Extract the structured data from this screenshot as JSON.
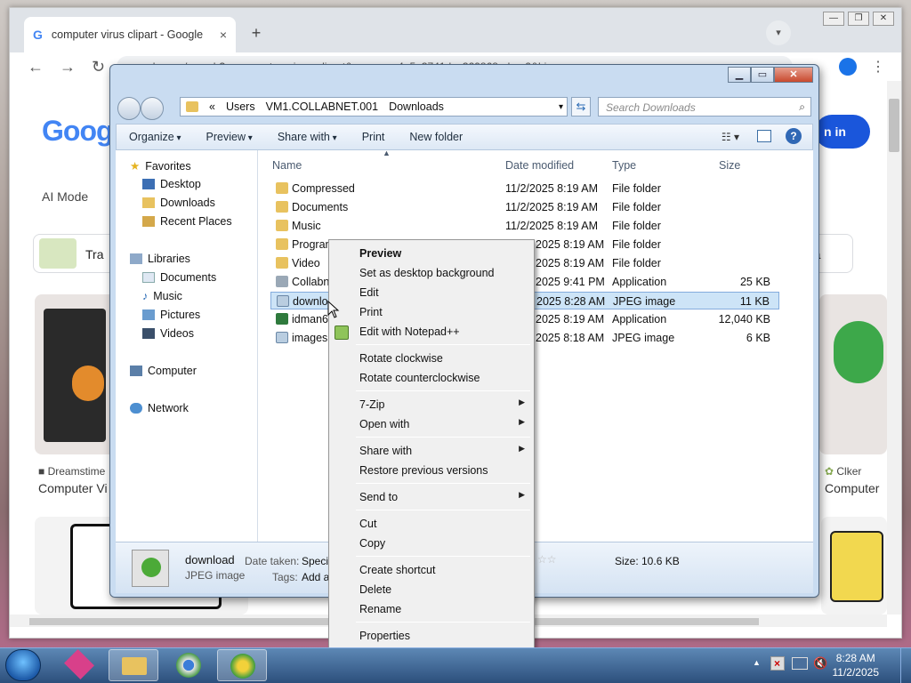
{
  "chrome": {
    "tab_title": "computer virus clipart - Google",
    "tab_close": "×",
    "new_tab": "+",
    "omnibox_text": "google.com/search?q=computer+virus+clipart&sca_esv=4a5e3741dec329868udm=2&biw=",
    "window_controls": [
      "—",
      "❐",
      "✕"
    ]
  },
  "google": {
    "logo": "Goog",
    "ai_mode": "AI Mode",
    "sign_in": "n in",
    "chip_left": "Tra",
    "chip_right": "ra",
    "source_left": "Dreamstime",
    "caption_left": "Computer Vi",
    "source_right": "Clker",
    "caption_right": "Computer"
  },
  "explorer": {
    "breadcrumb": [
      "«",
      "Users",
      "VM1.COLLABNET.001",
      "Downloads"
    ],
    "search_placeholder": "Search Downloads",
    "commands": [
      "Organize",
      "Preview",
      "Share with",
      "Print",
      "New folder"
    ],
    "nav": {
      "favorites": "Favorites",
      "desktop": "Desktop",
      "downloads": "Downloads",
      "recent": "Recent Places",
      "libraries": "Libraries",
      "documents": "Documents",
      "music": "Music",
      "pictures": "Pictures",
      "videos": "Videos",
      "computer": "Computer",
      "network": "Network"
    },
    "columns": {
      "name": "Name",
      "date": "Date modified",
      "type": "Type",
      "size": "Size"
    },
    "files": [
      {
        "name": "Compressed",
        "date": "11/2/2025 8:19 AM",
        "type": "File folder",
        "size": ""
      },
      {
        "name": "Documents",
        "date": "11/2/2025 8:19 AM",
        "type": "File folder",
        "size": ""
      },
      {
        "name": "Music",
        "date": "11/2/2025 8:19 AM",
        "type": "File folder",
        "size": ""
      },
      {
        "name": "Program",
        "date": "2025 8:19 AM",
        "type": "File folder",
        "size": ""
      },
      {
        "name": "Video",
        "date": "2025 8:19 AM",
        "type": "File folder",
        "size": ""
      },
      {
        "name": "Collabn",
        "date": "2025 9:41 PM",
        "type": "Application",
        "size": "25 KB"
      },
      {
        "name": "downlo",
        "date": "2025 8:28 AM",
        "type": "JPEG image",
        "size": "11 KB"
      },
      {
        "name": "idman6",
        "date": "2025 8:19 AM",
        "type": "Application",
        "size": "12,040 KB"
      },
      {
        "name": "images",
        "date": "2025 8:18 AM",
        "type": "JPEG image",
        "size": "6 KB"
      }
    ],
    "details": {
      "name": "download",
      "kind": "JPEG image",
      "date_taken_label": "Date taken:",
      "date_taken_value": "Specif",
      "tags_label": "Tags:",
      "tags_value": "Add a",
      "size": "Size: 10.6 KB"
    }
  },
  "context_menu": {
    "items": [
      "Preview",
      "Set as desktop background",
      "Edit",
      "Print",
      "Edit with Notepad++",
      "Rotate clockwise",
      "Rotate counterclockwise",
      "7-Zip",
      "Open with",
      "Share with",
      "Restore previous versions",
      "Send to",
      "Cut",
      "Copy",
      "Create shortcut",
      "Delete",
      "Rename",
      "Properties"
    ]
  },
  "taskbar": {
    "time": "8:28 AM",
    "date": "11/2/2025"
  },
  "colors": {
    "selection": "#cde4f7",
    "menu_bg": "#f0f0f0",
    "taskbar": "#3a6391",
    "google_blue": "#1a56db"
  }
}
